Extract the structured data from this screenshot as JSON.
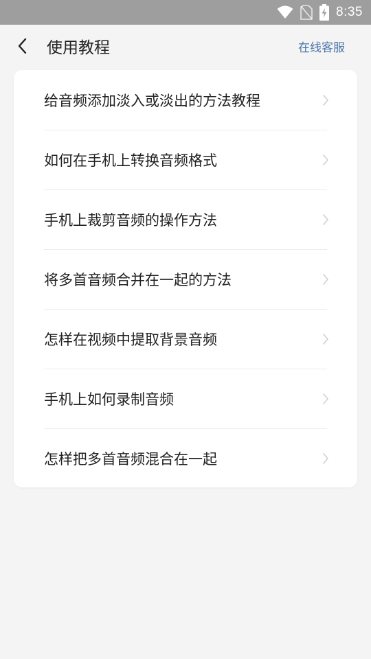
{
  "status_bar": {
    "time": "8:35",
    "icons": [
      "wifi-icon",
      "no-sim-icon",
      "battery-charging-icon"
    ]
  },
  "header": {
    "back_icon": "chevron-left-icon",
    "title": "使用教程",
    "service_link": "在线客服"
  },
  "tutorials": {
    "items": [
      {
        "label": "给音频添加淡入或淡出的方法教程"
      },
      {
        "label": "如何在手机上转换音频格式"
      },
      {
        "label": "手机上裁剪音频的操作方法"
      },
      {
        "label": "将多首音频合并在一起的方法"
      },
      {
        "label": "怎样在视频中提取背景音频"
      },
      {
        "label": "手机上如何录制音频"
      },
      {
        "label": "怎样把多首音频混合在一起"
      }
    ]
  },
  "colors": {
    "background": "#f4f4f4",
    "status_bar": "#9e9e9e",
    "link": "#4a74a8",
    "text": "#222222",
    "divider": "#ececec",
    "chevron": "#d0d0d0"
  }
}
